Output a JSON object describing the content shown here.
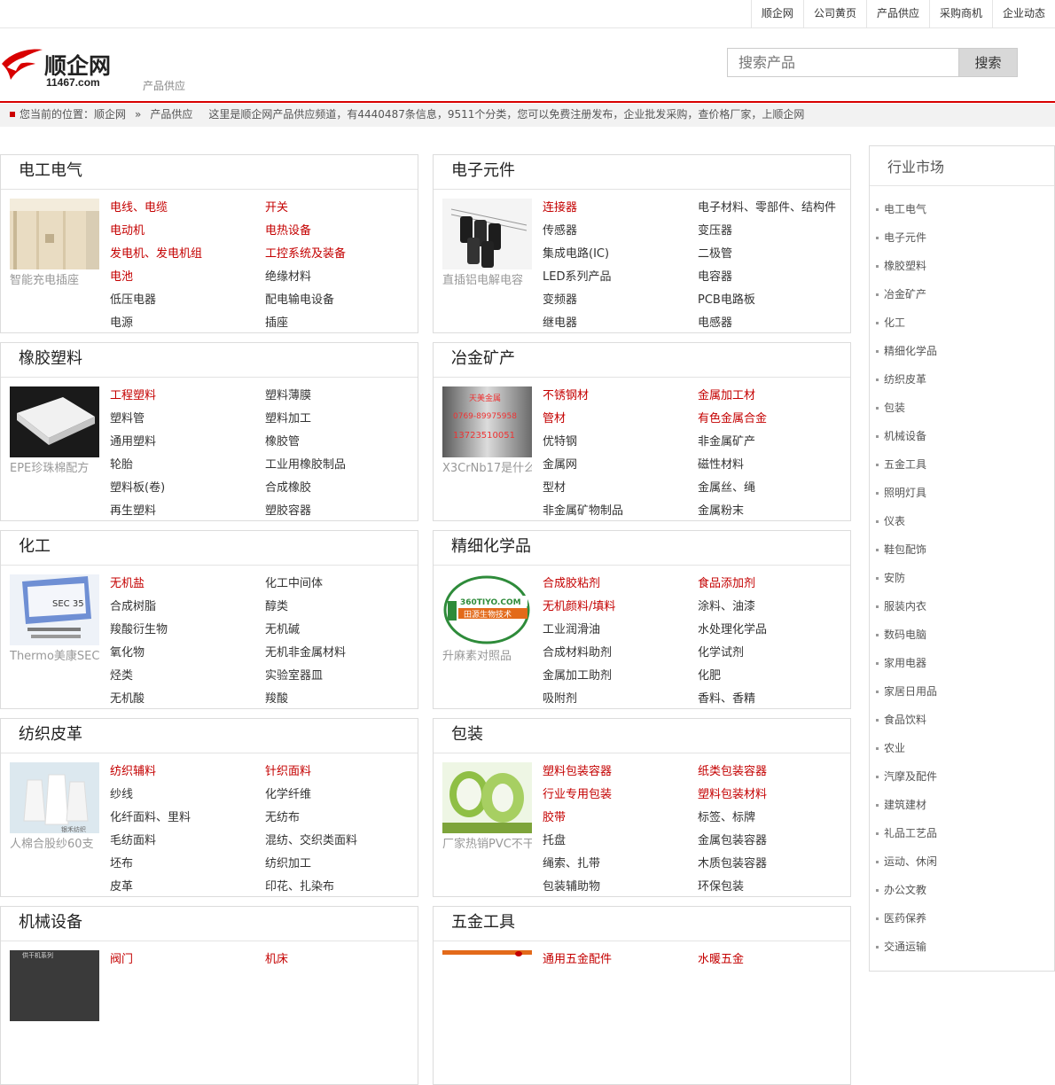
{
  "topnav": [
    "顺企网",
    "公司黄页",
    "产品供应",
    "采购商机",
    "企业动态"
  ],
  "logo": {
    "name": "顺企网",
    "domain": "11467.com"
  },
  "subtitle": "产品供应",
  "search": {
    "placeholder": "搜索产品",
    "button": "搜索"
  },
  "breadcrumb": {
    "prefix": "您当前的位置：",
    "home": "顺企网",
    "separator": "»",
    "current": "产品供应",
    "info": "这里是顺企网产品供应频道，有4440487条信息，9511个分类，您可以免费注册发布，企业批发采购，查价格厂家，上顺企网"
  },
  "categories": [
    {
      "title": "电工电气",
      "caption": "智能充电插座",
      "image": "wall-panel",
      "links": [
        {
          "text": "电线、电缆",
          "hot": true
        },
        {
          "text": "开关",
          "hot": true
        },
        {
          "text": "电动机",
          "hot": true
        },
        {
          "text": "电热设备",
          "hot": true
        },
        {
          "text": "发电机、发电机组",
          "hot": true
        },
        {
          "text": "工控系统及装备",
          "hot": true
        },
        {
          "text": "电池",
          "hot": true
        },
        {
          "text": "绝缘材料",
          "hot": false
        },
        {
          "text": "低压电器",
          "hot": false
        },
        {
          "text": "配电输电设备",
          "hot": false
        },
        {
          "text": "电源",
          "hot": false
        },
        {
          "text": "插座",
          "hot": false
        }
      ]
    },
    {
      "title": "电子元件",
      "caption": "直插铝电解电容",
      "image": "capacitors",
      "links": [
        {
          "text": "连接器",
          "hot": true
        },
        {
          "text": "电子材料、零部件、结构件",
          "hot": false
        },
        {
          "text": "传感器",
          "hot": false
        },
        {
          "text": "变压器",
          "hot": false
        },
        {
          "text": "集成电路(IC)",
          "hot": false
        },
        {
          "text": "二极管",
          "hot": false
        },
        {
          "text": "LED系列产品",
          "hot": false
        },
        {
          "text": "电容器",
          "hot": false
        },
        {
          "text": "变频器",
          "hot": false
        },
        {
          "text": "PCB电路板",
          "hot": false
        },
        {
          "text": "继电器",
          "hot": false
        },
        {
          "text": "电感器",
          "hot": false
        }
      ]
    },
    {
      "title": "橡胶塑料",
      "caption": "EPE珍珠棉配方",
      "image": "foam",
      "links": [
        {
          "text": "工程塑料",
          "hot": true
        },
        {
          "text": "塑料薄膜",
          "hot": false
        },
        {
          "text": "塑料管",
          "hot": false
        },
        {
          "text": "塑料加工",
          "hot": false
        },
        {
          "text": "通用塑料",
          "hot": false
        },
        {
          "text": "橡胶管",
          "hot": false
        },
        {
          "text": "轮胎",
          "hot": false
        },
        {
          "text": "工业用橡胶制品",
          "hot": false
        },
        {
          "text": "塑料板(卷)",
          "hot": false
        },
        {
          "text": "合成橡胶",
          "hot": false
        },
        {
          "text": "再生塑料",
          "hot": false
        },
        {
          "text": "塑胶容器",
          "hot": false
        }
      ]
    },
    {
      "title": "冶金矿产",
      "caption": "X3CrNb17是什么",
      "image": "steel",
      "image_text": [
        "天美金属",
        "0769-89975958",
        "13723510051"
      ],
      "links": [
        {
          "text": "不锈钢材",
          "hot": true
        },
        {
          "text": "金属加工材",
          "hot": true
        },
        {
          "text": "管材",
          "hot": true
        },
        {
          "text": "有色金属合金",
          "hot": true
        },
        {
          "text": "优特钢",
          "hot": false
        },
        {
          "text": "非金属矿产",
          "hot": false
        },
        {
          "text": "金属网",
          "hot": false
        },
        {
          "text": "磁性材料",
          "hot": false
        },
        {
          "text": "型材",
          "hot": false
        },
        {
          "text": "金属丝、绳",
          "hot": false
        },
        {
          "text": "非金属矿物制品",
          "hot": false
        },
        {
          "text": "金属粉末",
          "hot": false
        }
      ]
    },
    {
      "title": "化工",
      "caption": "Thermo美康SEC",
      "image": "lab-kit",
      "image_text": [
        "SEC 35"
      ],
      "links": [
        {
          "text": "无机盐",
          "hot": true
        },
        {
          "text": "化工中间体",
          "hot": false
        },
        {
          "text": "合成树脂",
          "hot": false
        },
        {
          "text": "醇类",
          "hot": false
        },
        {
          "text": "羧酸衍生物",
          "hot": false
        },
        {
          "text": "无机碱",
          "hot": false
        },
        {
          "text": "氧化物",
          "hot": false
        },
        {
          "text": "无机非金属材料",
          "hot": false
        },
        {
          "text": "烃类",
          "hot": false
        },
        {
          "text": "实验室器皿",
          "hot": false
        },
        {
          "text": "无机酸",
          "hot": false
        },
        {
          "text": "羧酸",
          "hot": false
        }
      ]
    },
    {
      "title": "精细化学品",
      "caption": "升麻素对照品",
      "image": "green-logo",
      "image_text": [
        "360TIYO.COM",
        "田源生物技术"
      ],
      "links": [
        {
          "text": "合成胶粘剂",
          "hot": true
        },
        {
          "text": "食品添加剂",
          "hot": true
        },
        {
          "text": "无机颜料/填料",
          "hot": true
        },
        {
          "text": "涂料、油漆",
          "hot": false
        },
        {
          "text": "工业润滑油",
          "hot": false
        },
        {
          "text": "水处理化学品",
          "hot": false
        },
        {
          "text": "合成材料助剂",
          "hot": false
        },
        {
          "text": "化学试剂",
          "hot": false
        },
        {
          "text": "金属加工助剂",
          "hot": false
        },
        {
          "text": "化肥",
          "hot": false
        },
        {
          "text": "吸附剂",
          "hot": false
        },
        {
          "text": "香料、香精",
          "hot": false
        }
      ]
    },
    {
      "title": "纺织皮革",
      "caption": "人棉合股纱60支",
      "image": "yarn",
      "image_text": [
        "银禾纺织"
      ],
      "links": [
        {
          "text": "纺织辅料",
          "hot": true
        },
        {
          "text": "针织面料",
          "hot": true
        },
        {
          "text": "纱线",
          "hot": false
        },
        {
          "text": "化学纤维",
          "hot": false
        },
        {
          "text": "化纤面料、里料",
          "hot": false
        },
        {
          "text": "无纺布",
          "hot": false
        },
        {
          "text": "毛纺面料",
          "hot": false
        },
        {
          "text": "混纺、交织类面料",
          "hot": false
        },
        {
          "text": "坯布",
          "hot": false
        },
        {
          "text": "纺织加工",
          "hot": false
        },
        {
          "text": "皮革",
          "hot": false
        },
        {
          "text": "印花、扎染布",
          "hot": false
        }
      ]
    },
    {
      "title": "包装",
      "caption": "厂家热销PVC不干胶",
      "image": "tape",
      "links": [
        {
          "text": "塑料包装容器",
          "hot": true
        },
        {
          "text": "纸类包装容器",
          "hot": true
        },
        {
          "text": "行业专用包装",
          "hot": true
        },
        {
          "text": "塑料包装材料",
          "hot": true
        },
        {
          "text": "胶带",
          "hot": true
        },
        {
          "text": "标签、标牌",
          "hot": false
        },
        {
          "text": "托盘",
          "hot": false
        },
        {
          "text": "金属包装容器",
          "hot": false
        },
        {
          "text": "绳索、扎带",
          "hot": false
        },
        {
          "text": "木质包装容器",
          "hot": false
        },
        {
          "text": "包装辅助物",
          "hot": false
        },
        {
          "text": "环保包装",
          "hot": false
        }
      ]
    },
    {
      "title": "机械设备",
      "caption": "",
      "image": "machine",
      "image_text": [
        "供干机系列"
      ],
      "links": [
        {
          "text": "阀门",
          "hot": true
        },
        {
          "text": "机床",
          "hot": true
        }
      ]
    },
    {
      "title": "五金工具",
      "caption": "",
      "image": "hardware",
      "links": [
        {
          "text": "通用五金配件",
          "hot": true
        },
        {
          "text": "水暖五金",
          "hot": true
        }
      ]
    }
  ],
  "sidebar": {
    "title": "行业市场",
    "items": [
      "电工电气",
      "电子元件",
      "橡胶塑料",
      "冶金矿产",
      "化工",
      "精细化学品",
      "纺织皮革",
      "包装",
      "机械设备",
      "五金工具",
      "照明灯具",
      "仪表",
      "鞋包配饰",
      "安防",
      "服装内衣",
      "数码电脑",
      "家用电器",
      "家居日用品",
      "食品饮料",
      "农业",
      "汽摩及配件",
      "建筑建材",
      "礼品工艺品",
      "运动、休闲",
      "办公文教",
      "医药保养",
      "交通运输"
    ]
  },
  "colors": {
    "brand_red": "#d80000",
    "hot_link": "#c40000"
  }
}
